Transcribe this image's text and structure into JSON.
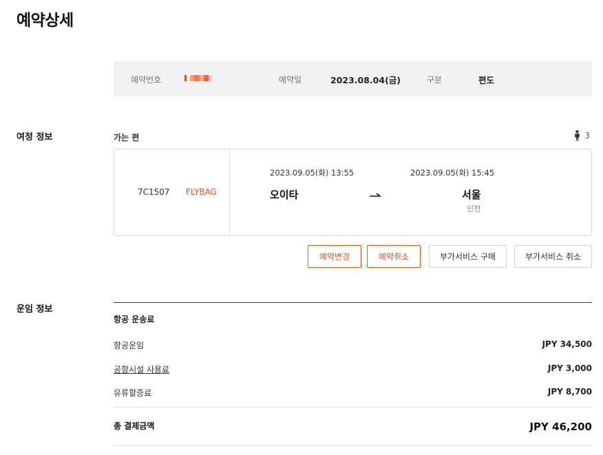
{
  "page": {
    "title": "예약상세"
  },
  "reservation": {
    "number_label": "예약번호",
    "date_label": "예약일",
    "date_value": "2023.08.04(금)",
    "type_label": "구분",
    "type_value": "편도"
  },
  "itinerary": {
    "section_label": "여정 정보",
    "leg_title": "가는 편",
    "passenger_count": "3",
    "flight": {
      "number": "7C1507",
      "fare_type": "FLYBAG",
      "departure_datetime": "2023.09.05(화) 13:55",
      "departure_city": "오이타",
      "arrival_datetime": "2023.09.05(화) 15:45",
      "arrival_city": "서울",
      "arrival_airport": "인천"
    },
    "buttons": {
      "change": "예약변경",
      "cancel": "예약취소",
      "addon_buy": "부가서비스 구매",
      "addon_cancel": "부가서비스 취소"
    }
  },
  "fare": {
    "section_label": "운임 정보",
    "group_title": "항공 운송료",
    "rows": [
      {
        "label": "항공운임",
        "value": "JPY 34,500"
      },
      {
        "label": "공항시설 사용료",
        "value": "JPY 3,000"
      },
      {
        "label": "유류할증료",
        "value": "JPY 8,700"
      }
    ],
    "total_label": "총 결제금액",
    "total_value": "JPY 46,200"
  },
  "colors": {
    "accent": "#e2541e",
    "info_bar_bg": "#f2f2f2"
  },
  "icons": {
    "passenger": "person-icon",
    "route": "arrow-right-icon"
  }
}
